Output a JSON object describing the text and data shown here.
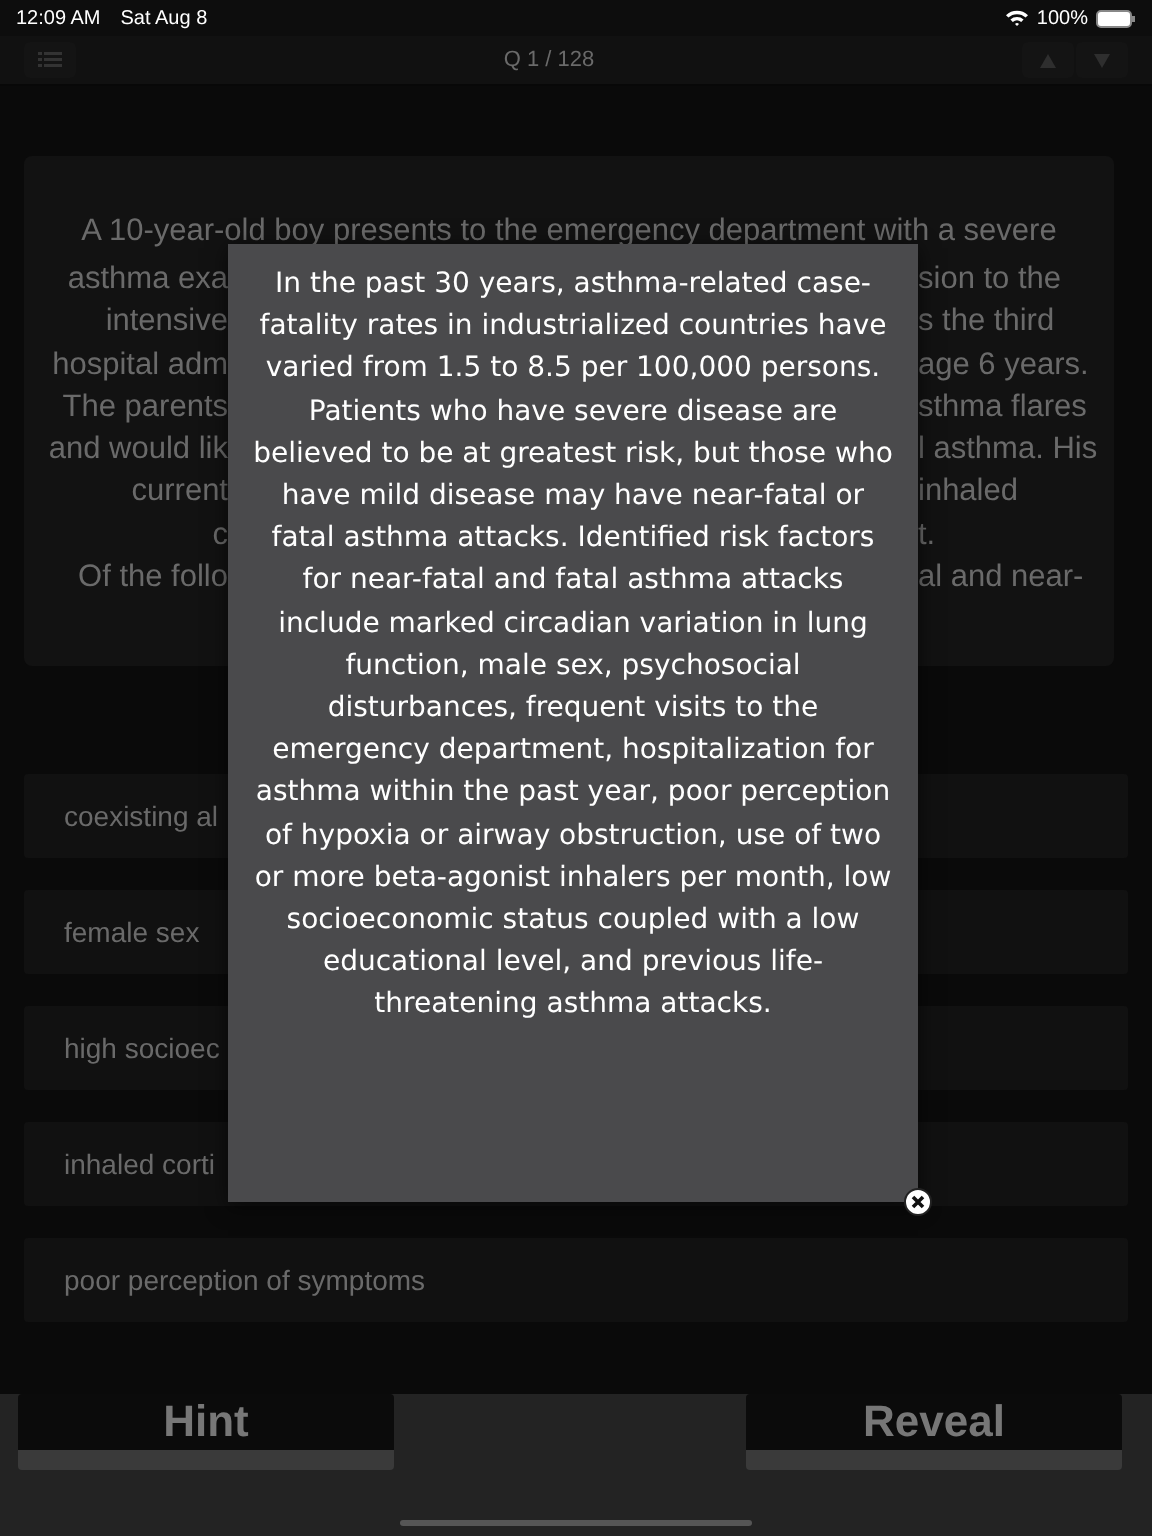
{
  "status_bar": {
    "time": "12:09 AM",
    "date": "Sat Aug 8",
    "battery": "100%"
  },
  "nav_bar": {
    "title": "Q 1 / 128"
  },
  "question": {
    "first_line": "A 10-year-old boy presents to the emergency department with a severe",
    "lines": [
      {
        "left": "asthma exa",
        "right": "sion to the"
      },
      {
        "left": "intensive",
        "right": "s the third"
      },
      {
        "left": "hospital adm",
        "right": "age 6 years."
      },
      {
        "left": "The parents",
        "right": "sthma flares"
      },
      {
        "left": "and would lik",
        "right": "l asthma. His"
      },
      {
        "left": "current",
        "right": "inhaled"
      },
      {
        "left": "c",
        "right": "t."
      },
      {
        "left": "Of the follo",
        "right": "al and near-"
      }
    ]
  },
  "options": [
    {
      "label": "coexisting al"
    },
    {
      "label": "female sex"
    },
    {
      "label": "high socioec"
    },
    {
      "label": "inhaled corti"
    },
    {
      "label": "poor perception of symptoms"
    }
  ],
  "popup": {
    "text": "In the past 30 years, asthma-related case-fatality rates in industrialized countries have varied from 1.5 to 8.5 per 100,000 persons. Patients who have severe disease are believed to be at greatest risk, but those who have mild disease may have near-fatal or fatal asthma attacks. Identified risk factors for near-fatal and fatal asthma attacks include marked circadian variation in lung function, male sex, psychosocial disturbances, frequent visits to the emergency department, hospitalization for asthma within the past year, poor perception of hypoxia or airway obstruction, use of two or more beta-agonist inhalers per month, low socioeconomic status coupled with a low educational level, and previous life-threatening asthma attacks."
  },
  "buttons": [
    "Hint",
    "Reveal"
  ]
}
